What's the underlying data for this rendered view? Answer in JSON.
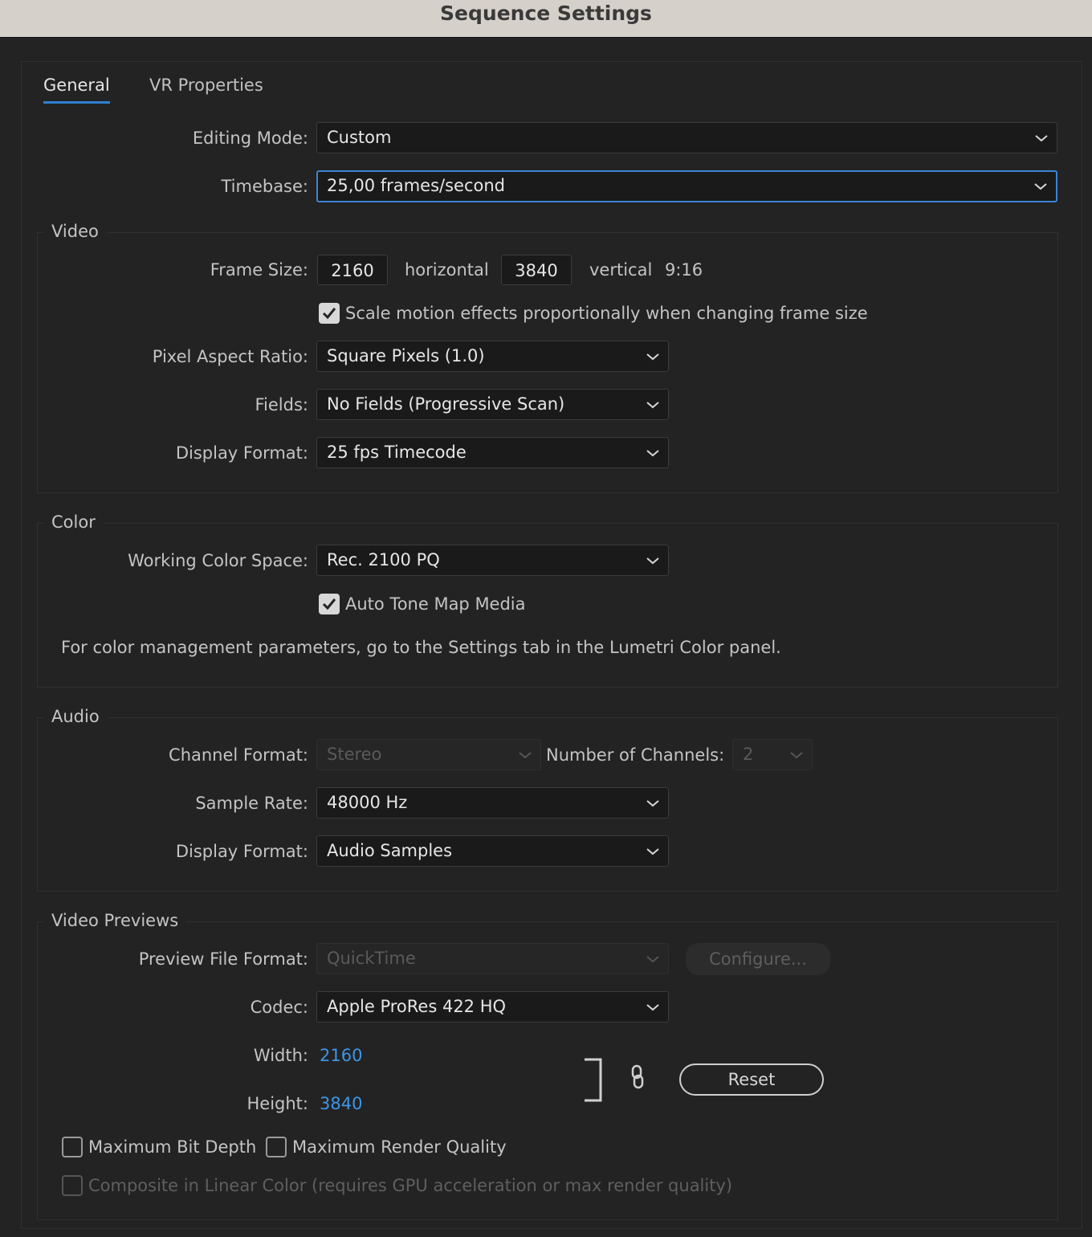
{
  "window": {
    "title": "Sequence Settings"
  },
  "tabs": [
    {
      "label": "General"
    },
    {
      "label": "VR Properties"
    }
  ],
  "editing_mode": {
    "label": "Editing Mode:",
    "value": "Custom"
  },
  "timebase": {
    "label": "Timebase:",
    "value": "25,00  frames/second"
  },
  "video": {
    "legend": "Video",
    "frame_size": {
      "label": "Frame Size:",
      "horizontal": "2160",
      "horizontal_label": "horizontal",
      "vertical": "3840",
      "vertical_label": "vertical",
      "aspect": "9:16"
    },
    "scale_motion": {
      "label": "Scale motion effects proportionally when changing frame size",
      "checked": true
    },
    "pixel_aspect_ratio": {
      "label": "Pixel Aspect Ratio:",
      "value": "Square Pixels (1.0)"
    },
    "fields": {
      "label": "Fields:",
      "value": "No Fields (Progressive Scan)"
    },
    "display_format": {
      "label": "Display Format:",
      "value": "25 fps Timecode"
    }
  },
  "color": {
    "legend": "Color",
    "working_color_space": {
      "label": "Working Color Space:",
      "value": "Rec. 2100 PQ"
    },
    "auto_tone_map": {
      "label": "Auto Tone Map Media",
      "checked": true
    },
    "note": "For color management parameters, go to the Settings tab in the Lumetri Color panel."
  },
  "audio": {
    "legend": "Audio",
    "channel_format": {
      "label": "Channel Format:",
      "value": "Stereo"
    },
    "number_of_channels": {
      "label": "Number of Channels:",
      "value": "2"
    },
    "sample_rate": {
      "label": "Sample Rate:",
      "value": "48000 Hz"
    },
    "display_format": {
      "label": "Display Format:",
      "value": "Audio Samples"
    }
  },
  "previews": {
    "legend": "Video Previews",
    "preview_file_format": {
      "label": "Preview File Format:",
      "value": "QuickTime"
    },
    "configure_label": "Configure...",
    "codec": {
      "label": "Codec:",
      "value": "Apple ProRes 422 HQ"
    },
    "width": {
      "label": "Width:",
      "value": "2160"
    },
    "height": {
      "label": "Height:",
      "value": "3840"
    },
    "reset_label": "Reset",
    "max_bit_depth": {
      "label": "Maximum Bit Depth",
      "checked": false
    },
    "max_render_quality": {
      "label": "Maximum Render Quality",
      "checked": false
    },
    "composite_linear": {
      "label": "Composite in Linear Color (requires GPU acceleration or max render quality)",
      "checked": false
    }
  },
  "colors": {
    "accent": "#3a85d6",
    "link": "#3d95e8",
    "background": "#232323",
    "titlebar": "#d6d0ca"
  }
}
